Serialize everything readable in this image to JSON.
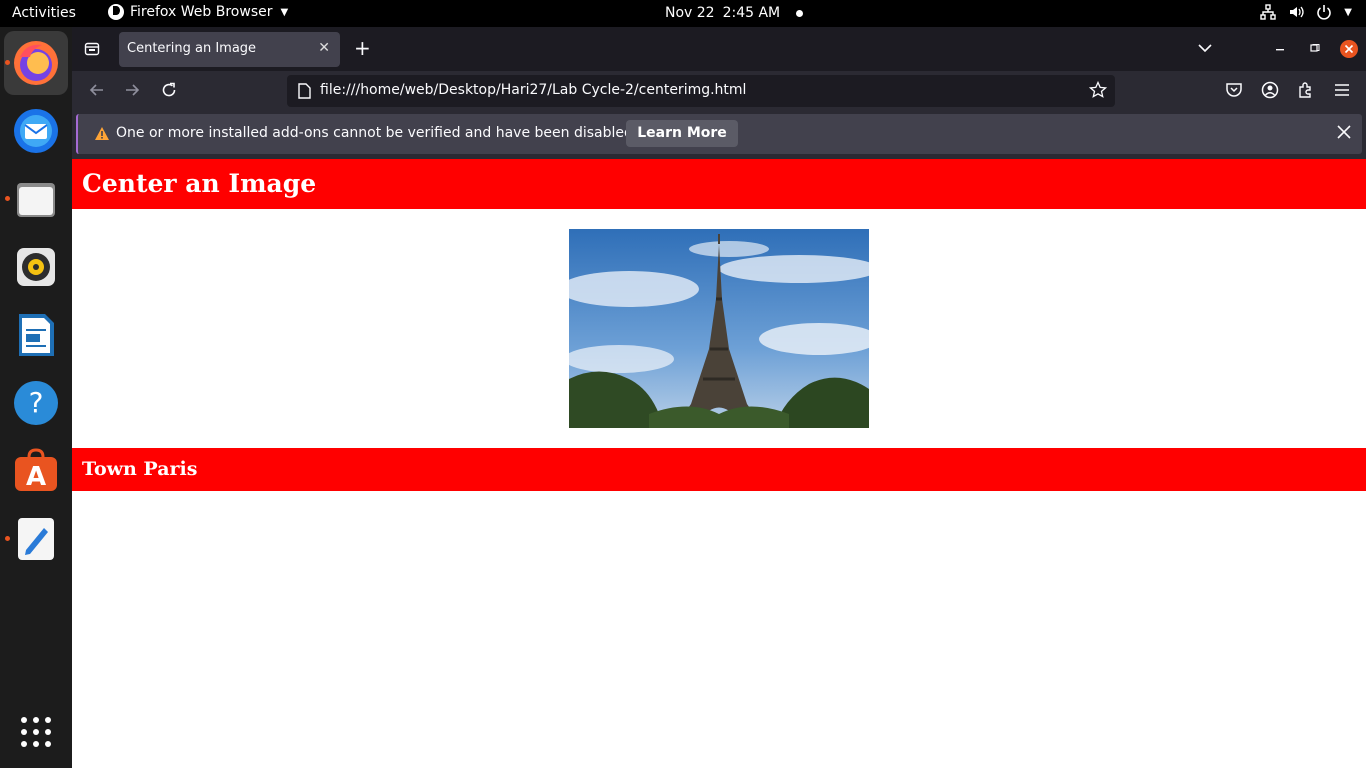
{
  "topbar": {
    "activities": "Activities",
    "app_name": "Firefox Web Browser",
    "date": "Nov 22",
    "time": "2:45 AM"
  },
  "dock": {
    "apps": [
      "firefox-icon",
      "thunderbird-icon",
      "files-icon",
      "rhythmbox-icon",
      "libreoffice-writer-icon",
      "help-icon",
      "app-center-icon",
      "text-editor-icon",
      "show-apps-icon"
    ],
    "accent": "#e95420"
  },
  "browser": {
    "tab_title": "Centering an Image",
    "url": "file:///home/web/Desktop/Hari27/Lab Cycle-2/centerimg.html",
    "notification": {
      "message": "One or more installed add-ons cannot be verified and have been disabled.",
      "button": "Learn More"
    }
  },
  "page": {
    "heading": "Center an Image",
    "subheading": "Town Paris",
    "banner_color": "#ff0000"
  }
}
